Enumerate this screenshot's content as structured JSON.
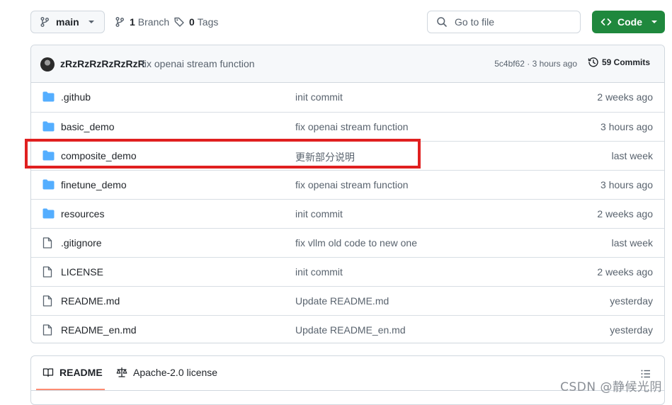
{
  "branch": {
    "name": "main",
    "branch_count": "1",
    "branch_label": "Branch",
    "tag_count": "0",
    "tag_label": "Tags"
  },
  "search": {
    "placeholder": "Go to file"
  },
  "code_button": {
    "label": "Code"
  },
  "latest_commit": {
    "author": "zRzRzRzRzRzRzR",
    "message": "fix openai stream function",
    "sha_time": "5c4bf62 · 3 hours ago",
    "commit_count_label": "59 Commits"
  },
  "files": [
    {
      "name": ".github",
      "type": "folder",
      "message": "init commit",
      "time": "2 weeks ago"
    },
    {
      "name": "basic_demo",
      "type": "folder",
      "message": "fix openai stream function",
      "time": "3 hours ago"
    },
    {
      "name": "composite_demo",
      "type": "folder",
      "message": "更新部分说明",
      "time": "last week"
    },
    {
      "name": "finetune_demo",
      "type": "folder",
      "message": "fix openai stream function",
      "time": "3 hours ago"
    },
    {
      "name": "resources",
      "type": "folder",
      "message": "init commit",
      "time": "2 weeks ago"
    },
    {
      "name": ".gitignore",
      "type": "file",
      "message": "fix vllm old code to new one",
      "time": "last week"
    },
    {
      "name": "LICENSE",
      "type": "file",
      "message": "init commit",
      "time": "2 weeks ago"
    },
    {
      "name": "README.md",
      "type": "file",
      "message": "Update README.md",
      "time": "yesterday"
    },
    {
      "name": "README_en.md",
      "type": "file",
      "message": "Update README_en.md",
      "time": "yesterday"
    }
  ],
  "readme": {
    "tab_label": "README",
    "license_label": "Apache-2.0 license"
  },
  "watermark": "CSDN @静候光阴",
  "icons": {
    "branch": "git-branch-icon",
    "tag": "tag-icon",
    "search": "search-icon",
    "code": "code-icon",
    "folder": "folder-icon",
    "file": "file-icon",
    "history": "history-icon",
    "book": "book-icon",
    "law": "law-icon",
    "list": "list-icon"
  },
  "colors": {
    "folder_icon": "#54aeff",
    "code_button": "#1f883d",
    "highlight_box": "#e02020",
    "active_tab_underline": "#fd8c73"
  }
}
